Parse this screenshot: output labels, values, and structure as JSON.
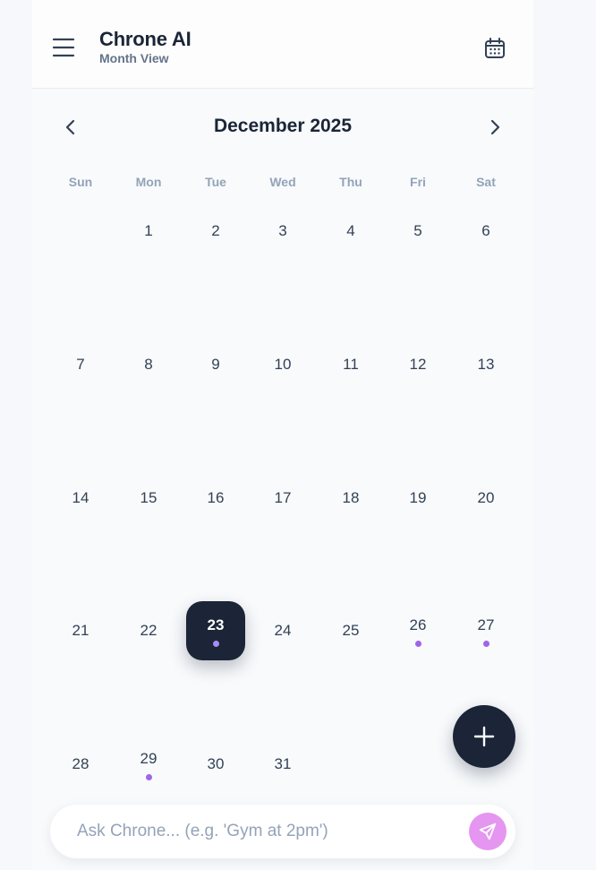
{
  "header": {
    "title": "Chrone AI",
    "subtitle": "Month View",
    "menu_icon": "hamburger-menu-icon",
    "calendar_icon": "calendar-icon"
  },
  "calendar": {
    "month_label": "December 2025",
    "prev_icon": "chevron-left-icon",
    "next_icon": "chevron-right-icon",
    "weekdays": [
      "Sun",
      "Mon",
      "Tue",
      "Wed",
      "Thu",
      "Fri",
      "Sat"
    ],
    "first_weekday_index": 1,
    "days_in_month": 31,
    "selected_day": 23,
    "days_with_events": [
      23,
      26,
      27,
      29
    ],
    "event_dot_color": "#a064e8"
  },
  "fab": {
    "icon": "plus-icon"
  },
  "chat": {
    "placeholder": "Ask Chrone... (e.g. 'Gym at 2pm')",
    "value": "",
    "send_icon": "send-icon"
  },
  "colors": {
    "primary": "#1b2537",
    "accent": "#e596f0",
    "muted": "#94a3b8"
  }
}
